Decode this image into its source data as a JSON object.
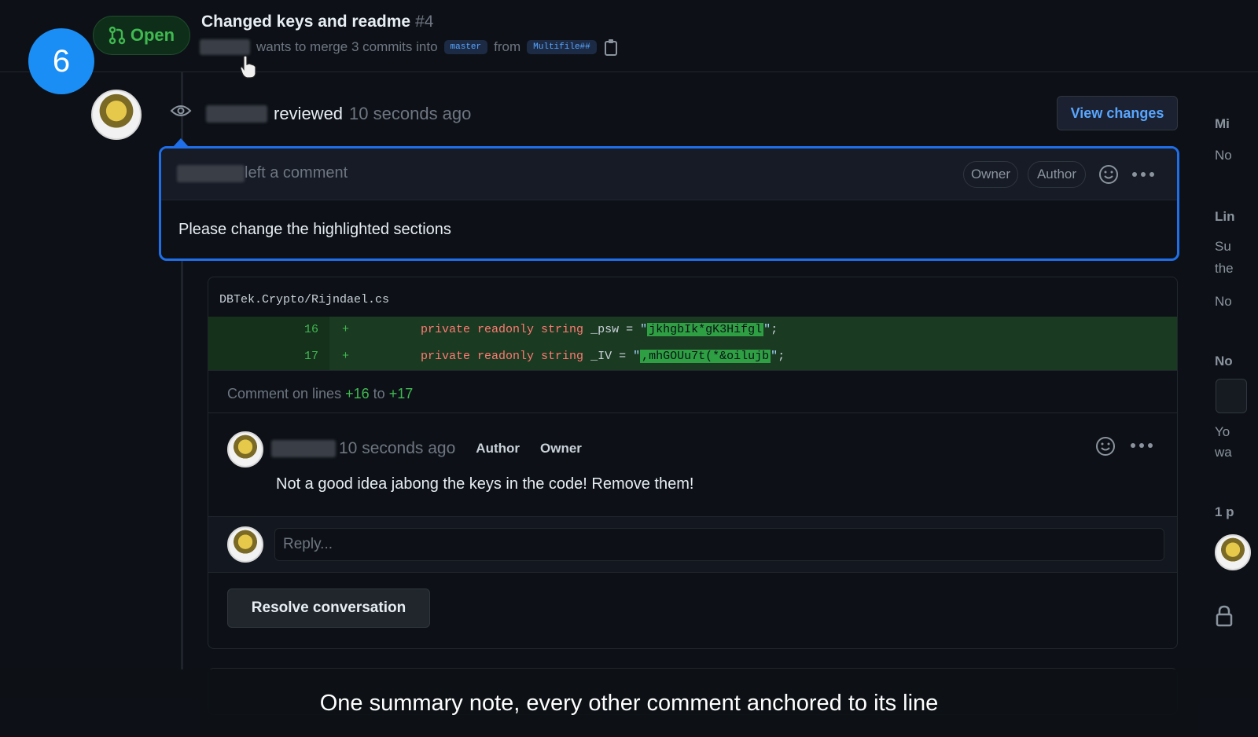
{
  "step_badge": "6",
  "header": {
    "state": "Open",
    "title": "Changed keys and readme",
    "number": "#4",
    "meta_text": "wants to merge 3 commits into",
    "base_branch": "master",
    "from_text": "from",
    "head_branch": "Multifile##"
  },
  "review": {
    "action": "reviewed",
    "time": "10 seconds ago",
    "view_changes_label": "View changes"
  },
  "summary_comment": {
    "header_text": "left a comment",
    "tags": [
      "Owner",
      "Author"
    ],
    "body": "Please change the highlighted sections"
  },
  "code_thread": {
    "file_path": "DBTek.Crypto/Rijndael.cs",
    "lines": [
      {
        "number": "16",
        "sign": "+",
        "keywords": "private readonly string",
        "ident": "_psw",
        "op": "=",
        "value": "jkhgbIk*gK3Hifgl"
      },
      {
        "number": "17",
        "sign": "+",
        "keywords": "private readonly string",
        "ident": "_IV",
        "op": "=",
        "value": ",mhGOUu7t(*&oilujb"
      }
    ],
    "comment_on_prefix": "Comment on lines",
    "line_from": "+16",
    "to_text": "to",
    "line_to": "+17",
    "inline_comment": {
      "time": "10 seconds ago",
      "tags": [
        "Author",
        "Owner"
      ],
      "body": "Not a good idea jabong the keys in the code! Remove them!"
    },
    "reply_placeholder": "Reply...",
    "resolve_label": "Resolve conversation"
  },
  "sidebar_fragments": [
    "Mi",
    "No",
    "Lin",
    "Su",
    "the",
    "No",
    "No",
    "Yo",
    "wa",
    "1 p"
  ],
  "caption": "One summary note, every other comment anchored to its line"
}
